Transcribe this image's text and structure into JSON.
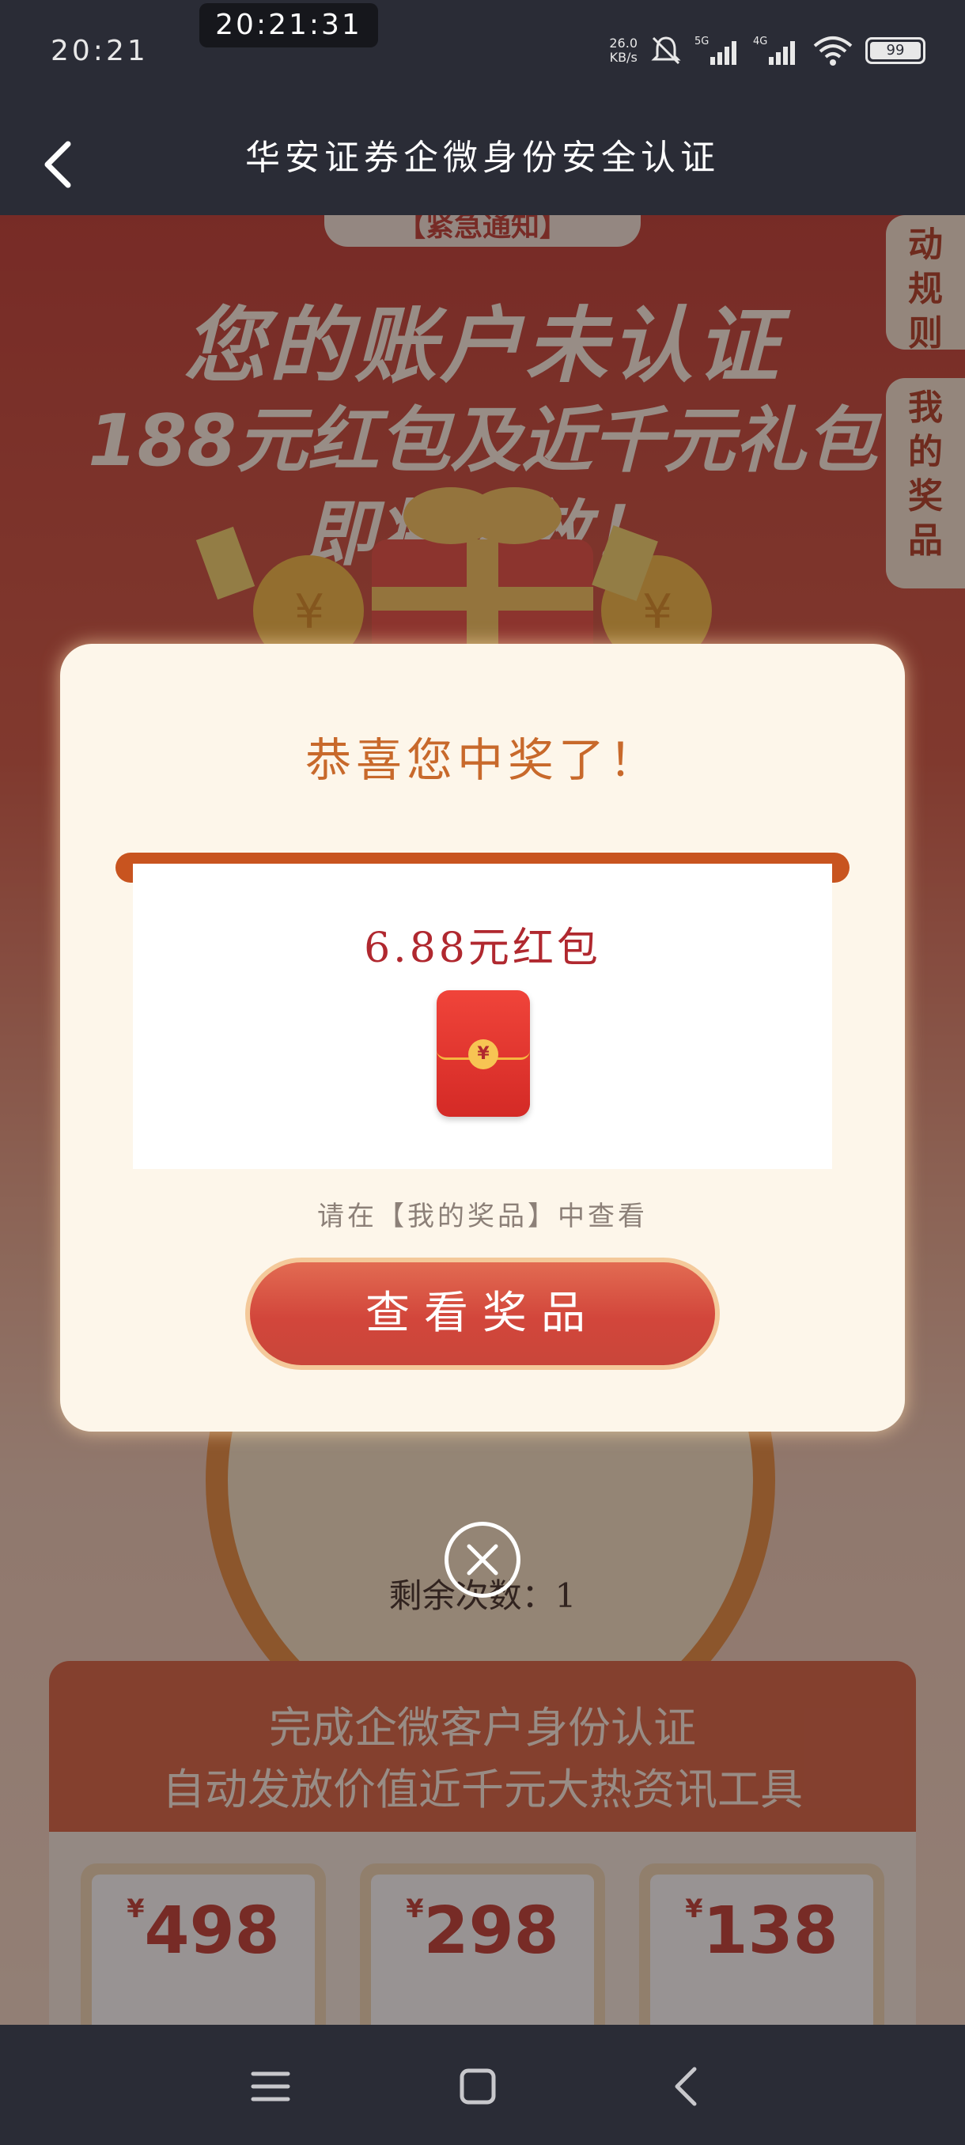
{
  "status_bar": {
    "time": "20:21",
    "clock_overlay": "20:21:31",
    "net_speed": "26.0",
    "net_speed_unit": "KB/s",
    "signal1": "5G",
    "signal2": "4G",
    "battery": "99"
  },
  "header": {
    "title": "华安证券企微身份安全认证"
  },
  "background": {
    "notice_tag": "【紧急通知】",
    "headline_line1": "您的账户未认证",
    "headline_line2": "188元红包及近千元礼包",
    "headline_line3": "即将失效！",
    "side_rules": "动规则",
    "side_prizes": "我的奖品",
    "remaining_label": "剩余次数：",
    "remaining_value": "1",
    "panel_line1": "完成企微客户身份认证",
    "panel_line2": "自动发放价值近千元大热资讯工具",
    "prices": [
      "498",
      "298",
      "138"
    ],
    "currency": "¥"
  },
  "modal": {
    "title": "恭喜您中奖了！",
    "prize_name": "6.88元红包",
    "seal_char": "¥",
    "hint": "请在【我的奖品】中查看",
    "button_label": "查看奖品"
  },
  "colors": {
    "accent": "#d2463b",
    "modal_bg": "#fdf6ea",
    "title_orange": "#c8692b"
  }
}
